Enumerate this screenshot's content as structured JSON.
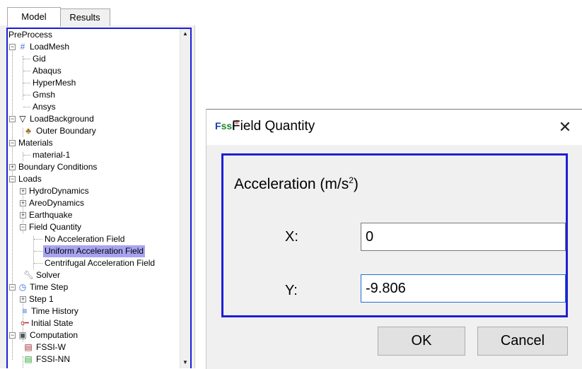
{
  "tabs": [
    {
      "label": "Model"
    },
    {
      "label": "Results"
    }
  ],
  "tree": {
    "items": [
      {
        "label": "PreProcess",
        "icon": ""
      },
      {
        "label": "LoadMesh",
        "icon": "mesh-icon"
      },
      {
        "label": "Gid"
      },
      {
        "label": "Abaqus"
      },
      {
        "label": "HyperMesh"
      },
      {
        "label": "Gmsh"
      },
      {
        "label": "Ansys"
      },
      {
        "label": "LoadBackground",
        "icon": "background-icon"
      },
      {
        "label": "Outer Boundary",
        "icon": "boundary-icon"
      },
      {
        "label": "Materials"
      },
      {
        "label": "material-1"
      },
      {
        "label": "Boundary Conditions"
      },
      {
        "label": "Loads"
      },
      {
        "label": "HydroDynamics"
      },
      {
        "label": "AreoDynamics"
      },
      {
        "label": "Earthquake"
      },
      {
        "label": "Field Quantity"
      },
      {
        "label": "No Acceleration Field"
      },
      {
        "label": "Uniform Acceleration Field",
        "selected": true
      },
      {
        "label": "Centrifugal Acceleration Field"
      },
      {
        "label": "Solver",
        "icon": "wrench-icon"
      },
      {
        "label": "Time Step",
        "icon": "clock-icon"
      },
      {
        "label": "Step 1"
      },
      {
        "label": "Time History",
        "icon": "time-history-icon"
      },
      {
        "label": "Initial State",
        "icon": "key-icon"
      },
      {
        "label": "Computation",
        "icon": "cpu-icon"
      },
      {
        "label": "FSSI-W",
        "icon": "computer-icon"
      },
      {
        "label": "FSSI-NN",
        "icon": "computer-icon"
      }
    ]
  },
  "dialog": {
    "logo": "Fssi",
    "title": "Field Quantity",
    "group_title": "Acceleration (m/s",
    "group_title_sup": "2",
    "group_title_end": ")",
    "x_label": "X:",
    "x_value": "0",
    "y_label": "Y:",
    "y_value": "-9.806",
    "ok_label": "OK",
    "cancel_label": "Cancel"
  },
  "colors": {
    "focus_border": "#1f1fd6",
    "selection": "#a8a4f2"
  }
}
